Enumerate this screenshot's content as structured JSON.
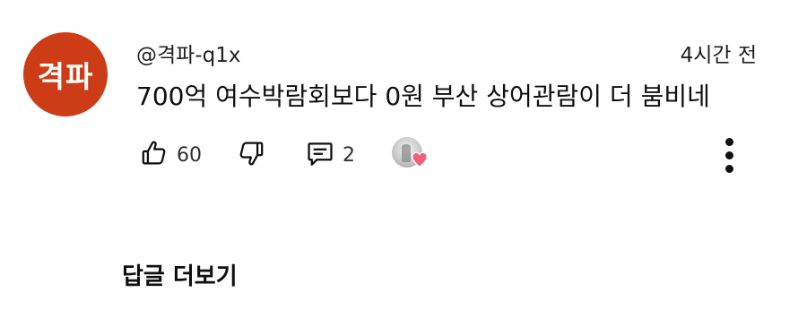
{
  "avatar": {
    "text": "격파",
    "color": "#cc3d17"
  },
  "comment": {
    "author": "@격파-q1x",
    "timestamp": "4시간 전",
    "text": "700억 여수박람회보다 0원 부산 상어관람이 더 붐비네"
  },
  "actions": {
    "like_icon": "thumbs-up-icon",
    "like_count": "60",
    "dislike_icon": "thumbs-down-icon",
    "reply_icon": "comment-icon",
    "reply_count": "2",
    "creator_heart_icon": "creator-heart-icon",
    "heart_color": "#f0607a",
    "more_icon": "more-vert-icon"
  },
  "more_replies_label": "답글 더보기"
}
